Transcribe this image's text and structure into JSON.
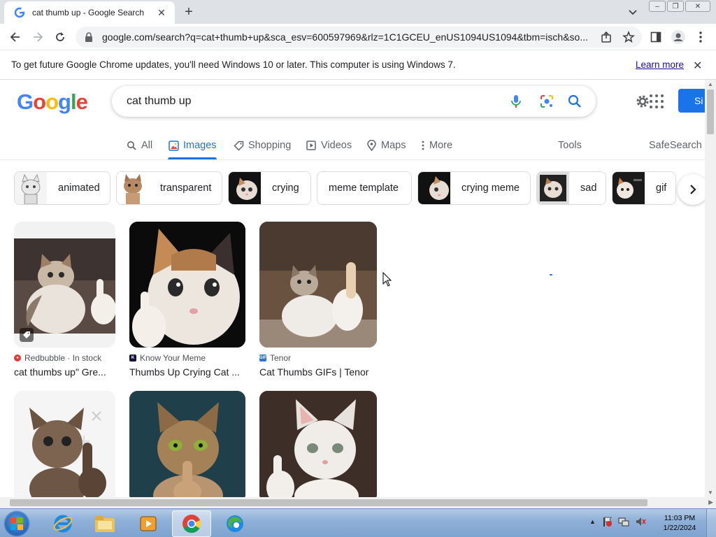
{
  "browser": {
    "tab_title": "cat thumb up - Google Search",
    "url": "google.com/search?q=cat+thumb+up&sca_esv=600597969&rlz=1C1GCEU_enUS1094US1094&tbm=isch&so..."
  },
  "infobar": {
    "message": "To get future Google Chrome updates, you'll need Windows 10 or later. This computer is using Windows 7.",
    "learn_more": "Learn more"
  },
  "google": {
    "logo_letters": [
      "G",
      "o",
      "o",
      "g",
      "l",
      "e"
    ],
    "query": "cat thumb up",
    "signin_label": "Si",
    "tabs": [
      {
        "label": "All",
        "icon": "search-icon"
      },
      {
        "label": "Images",
        "icon": "image-icon",
        "active": true
      },
      {
        "label": "Shopping",
        "icon": "tag-icon"
      },
      {
        "label": "Videos",
        "icon": "play-icon"
      },
      {
        "label": "Maps",
        "icon": "pin-icon"
      },
      {
        "label": "More",
        "icon": "more-icon"
      }
    ],
    "tools_label": "Tools",
    "safesearch_label": "SafeSearch",
    "chips": [
      "animated",
      "transparent",
      "crying",
      "meme template",
      "crying meme",
      "sad",
      "gif"
    ],
    "results": [
      {
        "source": "Redbubble · In stock",
        "title": "cat thumbs up\" Gre..."
      },
      {
        "source": "Know Your Meme",
        "title": "Thumbs Up Crying Cat ..."
      },
      {
        "source": "Tenor",
        "title": "Cat Thumbs GIFs | Tenor"
      }
    ]
  },
  "taskbar": {
    "time": "11:03 PM",
    "date": "1/22/2024"
  },
  "colors": {
    "accent": "#1a73e8",
    "chrome_tabstrip": "#dee1e6",
    "link": "#1a0dab"
  }
}
